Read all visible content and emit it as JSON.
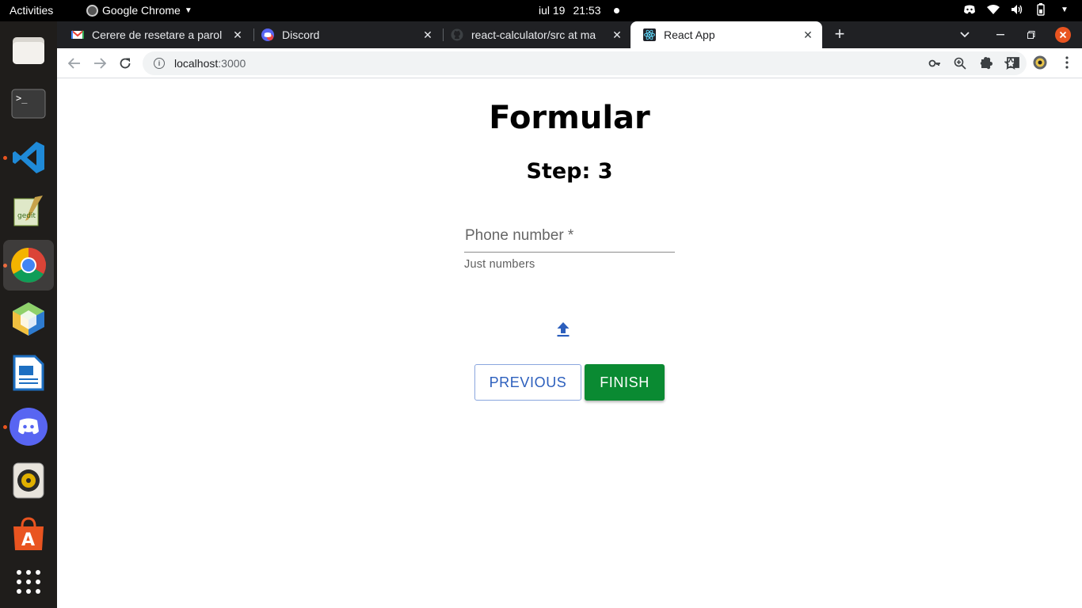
{
  "topbar": {
    "activities": "Activities",
    "app_name": "Google Chrome",
    "date": "iul 19",
    "time": "21:53"
  },
  "dock": {
    "items": [
      "files-icon",
      "terminal-icon",
      "vscode-icon",
      "text-editor-icon",
      "chrome-icon",
      "netbeans-icon",
      "writer-icon",
      "discord-icon",
      "rhythmbox-icon",
      "app-center-icon",
      "show-apps-icon"
    ]
  },
  "browser": {
    "tabs": [
      {
        "title": "Cerere de resetare a parol",
        "favicon": "gmail-icon"
      },
      {
        "title": "Discord",
        "favicon": "discord-icon"
      },
      {
        "title": "react-calculator/src at ma",
        "favicon": "github-icon"
      },
      {
        "title": "React App",
        "favicon": "react-icon",
        "active": true
      }
    ],
    "url_host": "localhost",
    "url_port": ":3000"
  },
  "page": {
    "title": "Formular",
    "step_label": "Step: 3",
    "phone_label": "Phone number *",
    "phone_helper": "Just numbers",
    "previous_label": "PREVIOUS",
    "finish_label": "FINISH"
  },
  "colors": {
    "primary": "#2c5fbd",
    "finish": "#0a8a32",
    "tabstrip": "#202124"
  }
}
